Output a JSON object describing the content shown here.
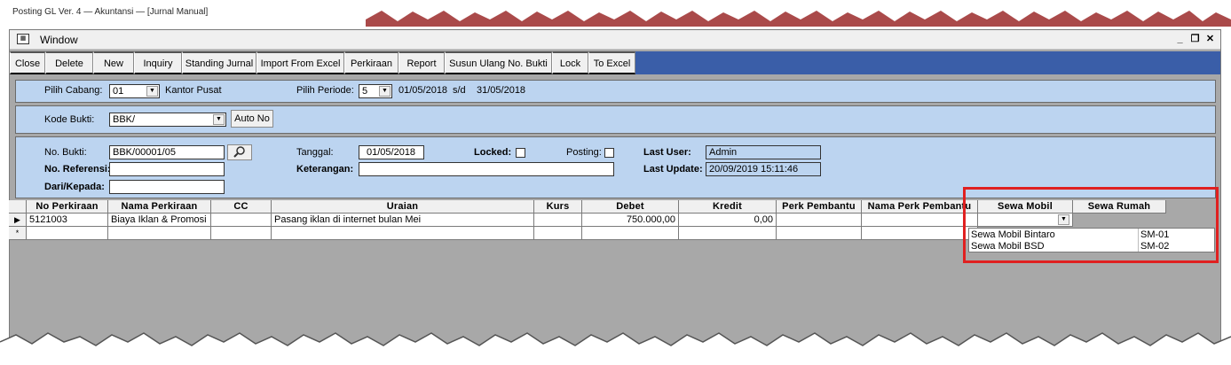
{
  "app_title_strip": "Posting GL Ver. 4 — Akuntansi — [Jurnal Manual]",
  "window": {
    "title": "Window"
  },
  "toolbar": {
    "buttons": [
      "Close",
      "Delete",
      "New",
      "Inquiry",
      "Standing Jurnal",
      "Import From Excel",
      "Perkiraan",
      "Report",
      "Susun Ulang No. Bukti",
      "Lock",
      "To Excel"
    ]
  },
  "cabang": {
    "label": "Pilih Cabang:",
    "value": "01",
    "name": "Kantor Pusat"
  },
  "periode": {
    "label": "Pilih Periode:",
    "value": "5",
    "start": "01/05/2018",
    "sd": "s/d",
    "end": "31/05/2018"
  },
  "kode_bukti": {
    "label": "Kode Bukti:",
    "value": "BBK/",
    "auto_no": "Auto No"
  },
  "header": {
    "no_bukti_label": "No. Bukti:",
    "no_bukti": "BBK/00001/05",
    "no_ref_label": "No. Referensi:",
    "no_ref": "",
    "dari_label": "Dari/Kepada:",
    "dari": "",
    "tanggal_label": "Tanggal:",
    "tanggal": "01/05/2018",
    "keterangan_label": "Keterangan:",
    "keterangan": "",
    "locked_label": "Locked:",
    "locked": false,
    "posting_label": "Posting:",
    "posting": false,
    "last_user_label": "Last User:",
    "last_user": "Admin",
    "last_update_label": "Last Update:",
    "last_update": "20/09/2019 15:11:46"
  },
  "grid": {
    "columns": [
      "No Perkiraan",
      "Nama Perkiraan",
      "CC",
      "Uraian",
      "Kurs",
      "Debet",
      "Kredit",
      "Perk Pembantu",
      "Nama Perk Pembantu",
      "Sewa Mobil",
      "Sewa Rumah"
    ],
    "rows": [
      [
        "5121003",
        "Biaya Iklan & Promosi",
        "",
        "Pasang iklan di internet bulan Mei",
        "",
        "750.000,00",
        "0,00",
        "",
        "",
        "",
        ""
      ]
    ],
    "new_row_marker": "*"
  },
  "dropdown": {
    "options": [
      {
        "name": "Sewa Mobil Bintaro",
        "code": "SM-01"
      },
      {
        "name": "Sewa Mobil BSD",
        "code": "SM-02"
      }
    ]
  },
  "colors": {
    "panel": "#bcd4f0",
    "toolbar_bg": "#3a5ea8",
    "highlight": "#e02020",
    "grid_bg": "#a8a8a8"
  }
}
